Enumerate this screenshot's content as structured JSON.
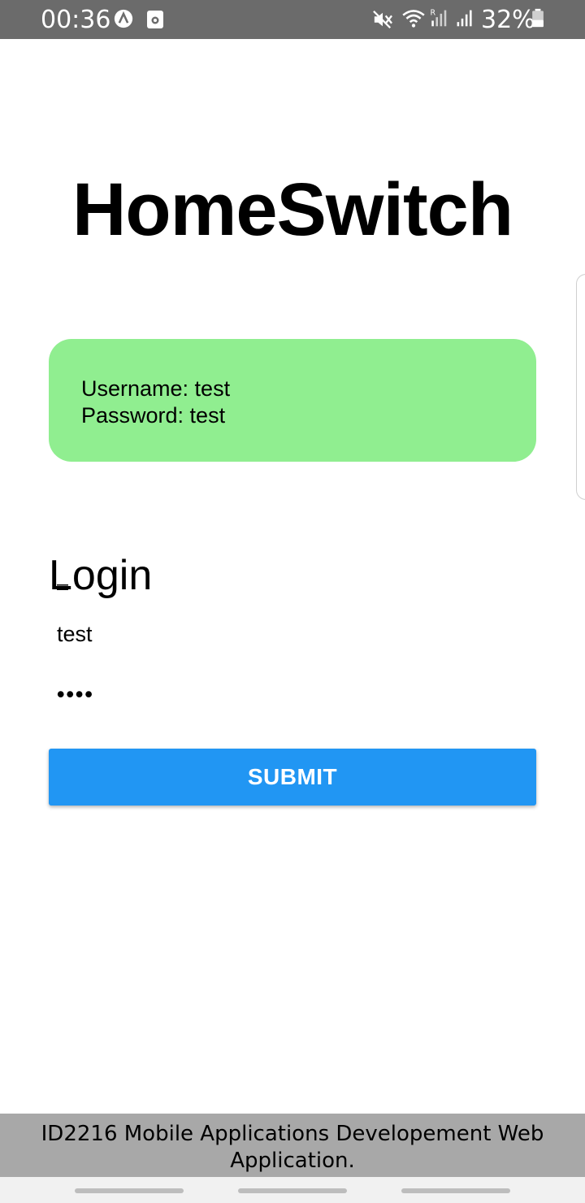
{
  "status_bar": {
    "time": "00:36",
    "battery_percent": "32%",
    "icons": [
      "a-circle-icon",
      "calendar-icon",
      "mute-icon",
      "wifi-icon",
      "signal-roaming-icon",
      "signal-icon",
      "battery-icon"
    ]
  },
  "app": {
    "title": "HomeSwitch"
  },
  "credentials": {
    "username_line": "Username: test",
    "password_line": "Password: test",
    "background_color": "#90ee90"
  },
  "login": {
    "heading": "Login",
    "username_value": "test",
    "password_value": "••••",
    "submit_label": "SUBMIT",
    "accent_color": "#2196f3"
  },
  "footer": {
    "text": "ID2216 Mobile Applications Developement Web Application."
  }
}
